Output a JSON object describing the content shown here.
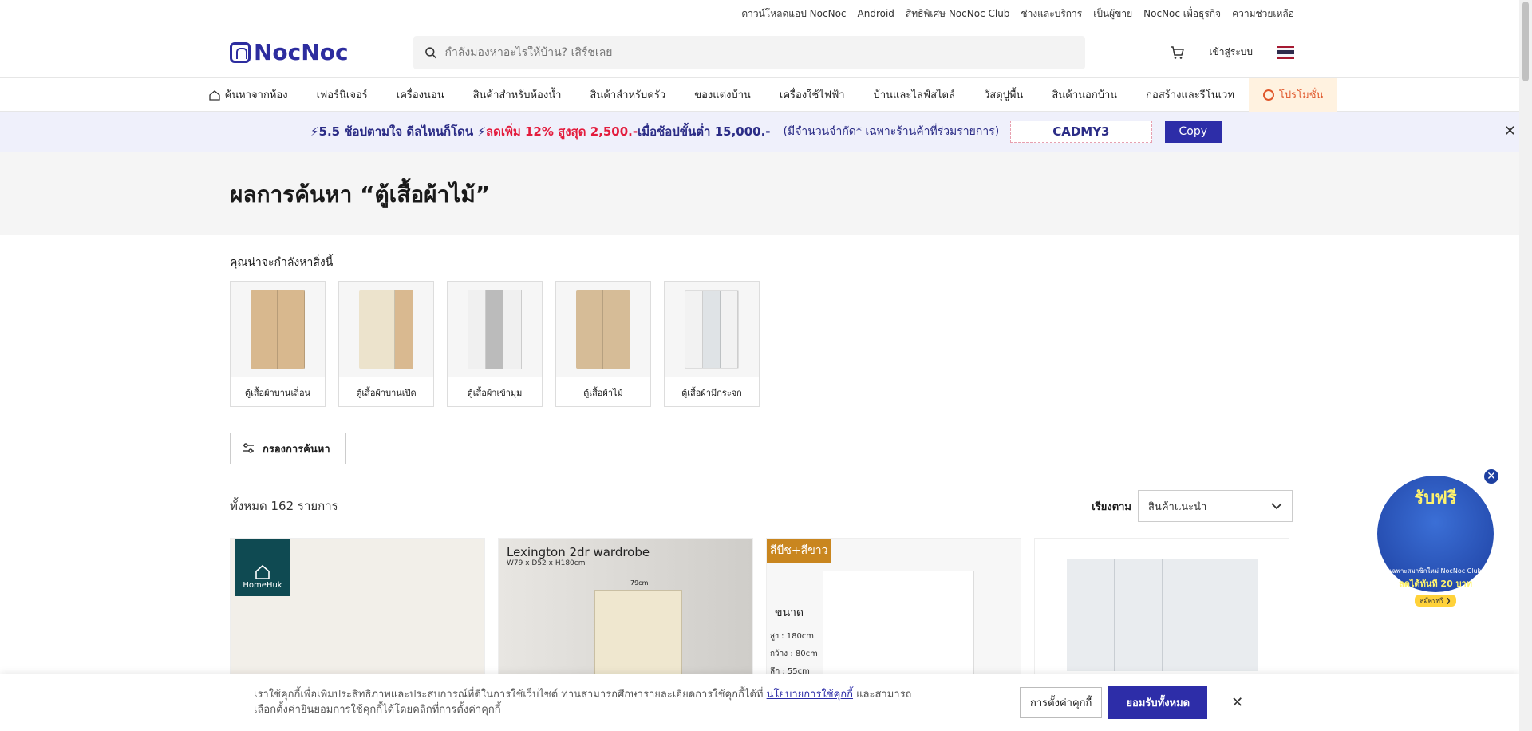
{
  "top_links": [
    "ดาวน์โหลดแอป NocNoc",
    "Android",
    "สิทธิพิเศษ NocNoc Club",
    "ช่างและบริการ",
    "เป็นผู้ขาย",
    "NocNoc เพื่อธุรกิจ",
    "ความช่วยเหลือ"
  ],
  "header": {
    "logo_text": "NocNoc",
    "search_placeholder": "กำลังมองหาอะไรให้บ้าน? เสิร์ชเลย",
    "login_label": "เข้าสู่ระบบ"
  },
  "categories": [
    "ค้นหาจากห้อง",
    "เฟอร์นิเจอร์",
    "เครื่องนอน",
    "สินค้าสำหรับห้องน้ำ",
    "สินค้าสำหรับครัว",
    "ของแต่งบ้าน",
    "เครื่องใช้ไฟฟ้า",
    "บ้านและไลฟ์สไตล์",
    "วัสดุปูพื้น",
    "สินค้านอกบ้าน",
    "ก่อสร้างและรีโนเวท",
    "โปรโมชั่น"
  ],
  "banner": {
    "part1": "⚡5.5 ช้อปตามใจ ดีลไหนก็โดน ⚡",
    "part2": "ลดเพิ่ม 12% สูงสุด 2,500.-",
    "part3": " เมื่อช้อปขั้นต่ำ 15,000.-",
    "part4": "(มีจำนวนจำกัด* เฉพาะร้านค้าที่ร่วมรายการ)",
    "coupon_code": "CADMY3",
    "copy_label": "Copy"
  },
  "results": {
    "title": "ผลการค้นหา “ตู้เสื้อผ้าไม้”",
    "maybe_label": "คุณน่าจะกำลังหาสิ่งนี้",
    "suggestions": [
      "ตู้เสื้อผ้าบานเลื่อน",
      "ตู้เสื้อผ้าบานเปิด",
      "ตู้เสื้อผ้าเข้ามุม",
      "ตู้เสื้อผ้าไม้",
      "ตู้เสื้อผ้ามีกระจก"
    ],
    "filter_label": "กรองการค้นหา",
    "count_label": "ทั้งหมด 162 รายการ",
    "sort_label": "เรียงตาม",
    "sort_value": "สินค้าแนะนำ"
  },
  "products": {
    "p1_brand": "HomeHuk",
    "p2_title": "Lexington 2dr wardrobe",
    "p2_sub": "W79 x D52 x H180cm",
    "p2_dim": "79cm",
    "p3_tag": "สีบีช+สีขาว",
    "p3_size": "ขนาด",
    "p3_dims": [
      "สูง : 180cm",
      "กว้าง : 80cm",
      "ลึก : 55cm"
    ]
  },
  "cookie": {
    "text_before": "เราใช้คุกกี้เพื่อเพิ่มประสิทธิภาพและประสบการณ์ที่ดีในการใช้เว็บไซต์ ท่านสามารถศึกษารายละเอียดการใช้คุกกี้ได้ที่ ",
    "link": "นโยบายการใช้คุกกี้",
    "text_after": " และสามารถเลือกตั้งค่ายินยอมการใช้คุกกี้ได้โดยคลิกที่การตั้งค่าคุกกี้",
    "settings_label": "การตั้งค่าคุกกี้",
    "accept_label": "ยอมรับทั้งหมด"
  },
  "float_promo": {
    "title": "รับฟรี",
    "line1": "เฉพาะสมาชิกใหม่ NocNoc Club",
    "line2": "ลดได้ทันที 20 บาท",
    "cta": "สมัครฟรี ❯"
  },
  "colors": {
    "brand": "#2d2d9f",
    "promo": "#e0572a",
    "banner_red": "#e31c3d"
  }
}
